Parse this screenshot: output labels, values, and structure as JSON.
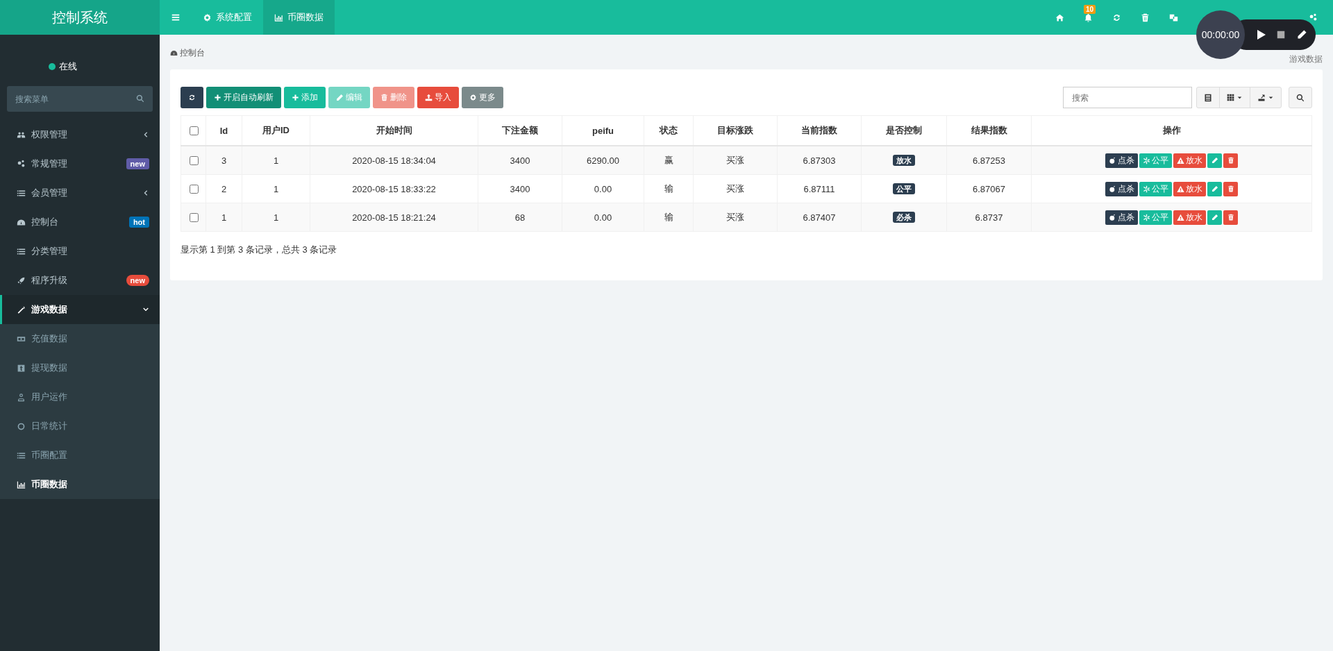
{
  "header": {
    "brand": "控制系统",
    "tabs": [
      {
        "label": "系统配置",
        "selected": false
      },
      {
        "label": "币圈数据",
        "selected": true
      }
    ],
    "notification_count": "10"
  },
  "recorder": {
    "time": "00:00:00"
  },
  "sidebar": {
    "status": "在线",
    "search": {
      "placeholder": "搜索菜单"
    },
    "items": [
      {
        "label": "权限管理",
        "selected": false,
        "expanded": false
      },
      {
        "label": "常规管理",
        "selected": false,
        "badge": {
          "text": "new",
          "color": "#605ca8",
          "kind": "label"
        }
      },
      {
        "label": "会员管理",
        "selected": false,
        "expanded": false
      },
      {
        "label": "控制台",
        "selected": false,
        "badge": {
          "text": "hot",
          "color": "#0073b7",
          "kind": "label"
        }
      },
      {
        "label": "分类管理",
        "selected": false
      },
      {
        "label": "程序升级",
        "selected": false,
        "badge": {
          "text": "new",
          "color": "#e74c3c",
          "kind": "pill"
        }
      },
      {
        "label": "游戏数据",
        "selected": true,
        "expanded": true,
        "children": [
          {
            "label": "充值数据",
            "selected": false
          },
          {
            "label": "提现数据",
            "selected": false
          },
          {
            "label": "用户运作",
            "selected": false
          },
          {
            "label": "日常统计",
            "selected": false
          },
          {
            "label": "币圈配置",
            "selected": false
          },
          {
            "label": "币圈数据",
            "selected": true
          }
        ]
      }
    ]
  },
  "breadcrumb": {
    "label": "控制台",
    "page_title": "游戏数据"
  },
  "toolbar": {
    "buttons": [
      {
        "kind": "refresh",
        "disabled": false
      },
      {
        "kind": "auto",
        "label": "开启自动刷新",
        "disabled": false
      },
      {
        "kind": "add",
        "label": "添加",
        "disabled": false
      },
      {
        "kind": "edit",
        "label": "编辑",
        "disabled": true
      },
      {
        "kind": "delete",
        "label": "删除",
        "disabled": true
      },
      {
        "kind": "import",
        "label": "导入",
        "disabled": false
      },
      {
        "kind": "more",
        "label": "更多",
        "disabled": false
      }
    ],
    "search": {
      "placeholder": "搜索"
    }
  },
  "table": {
    "select_all": {
      "checked": false
    },
    "columns": [
      "Id",
      "用户ID",
      "开始时间",
      "下注金额",
      "peifu",
      "状态",
      "目标涨跌",
      "当前指数",
      "是否控制",
      "结果指数",
      "操作"
    ],
    "rows": [
      {
        "checked": false,
        "cells": [
          "3",
          "1",
          "2020-08-15 18:34:04",
          "3400",
          "6290.00",
          "赢",
          "买涨",
          "6.87303"
        ],
        "control": "放水",
        "result": "6.87253",
        "actions": [
          "点杀",
          "公平",
          "放水"
        ]
      },
      {
        "checked": false,
        "cells": [
          "2",
          "1",
          "2020-08-15 18:33:22",
          "3400",
          "0.00",
          "输",
          "买涨",
          "6.87111"
        ],
        "control": "公平",
        "result": "6.87067",
        "actions": [
          "点杀",
          "公平",
          "放水"
        ]
      },
      {
        "checked": false,
        "cells": [
          "1",
          "1",
          "2020-08-15 18:21:24",
          "68",
          "0.00",
          "输",
          "买涨",
          "6.87407"
        ],
        "control": "必杀",
        "result": "6.8737",
        "actions": [
          "点杀",
          "公平",
          "放水"
        ]
      }
    ]
  },
  "footer": "显示第 1 到第 3 条记录，总共 3 条记录"
}
